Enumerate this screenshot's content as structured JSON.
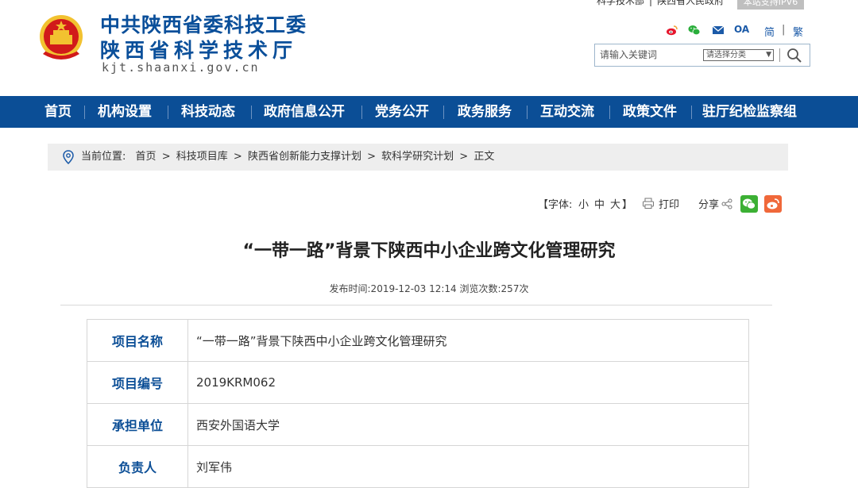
{
  "header": {
    "title_line1": "中共陕西省委科技工委",
    "title_line2": "陕西省科学技术厅",
    "domain": "kjt.shaanxi.gov.cn",
    "toplinks": [
      "科学技术部",
      "|",
      "陕西省人民政府"
    ],
    "ipv6_badge": "本站支持IPV6",
    "icons": [
      "weibo-icon",
      "wechat-icon",
      "mail-icon"
    ],
    "oa_label": "OA",
    "lang_simplified": "简",
    "lang_sep": "|",
    "lang_traditional": "繁",
    "search_placeholder": "请输入关键词",
    "search_category": "请选择分类",
    "colors": {
      "brand_blue": "#0b4e96",
      "emblem_red": "#d11a1a",
      "emblem_gold": "#f2c230"
    }
  },
  "nav": {
    "items": [
      "首页",
      "机构设置",
      "科技动态",
      "政府信息公开",
      "党务公开",
      "政务服务",
      "互动交流",
      "政策文件",
      "驻厅纪检监察组"
    ]
  },
  "breadcrumb": {
    "label": "当前位置:",
    "items": [
      "首页",
      ">",
      "科技项目库",
      ">",
      "陕西省创新能力支撑计划",
      ">",
      "软科学研究计划",
      ">",
      "正文"
    ]
  },
  "tools": {
    "font_label": "【字体:",
    "font_small": "小",
    "font_medium": "中",
    "font_large": "大",
    "font_close": "】",
    "print_label": "打印",
    "share_label": "分享"
  },
  "article": {
    "title": "“一带一路”背景下陕西中小企业跨文化管理研究",
    "meta": "发布时间:2019-12-03 12:14   浏览次数:257次",
    "rows": [
      {
        "key": "项目名称",
        "value": "“一带一路”背景下陕西中小企业跨文化管理研究"
      },
      {
        "key": "项目编号",
        "value": "2019KRM062"
      },
      {
        "key": "承担单位",
        "value": "西安外国语大学"
      },
      {
        "key": "负责人",
        "value": "刘军伟"
      }
    ]
  }
}
